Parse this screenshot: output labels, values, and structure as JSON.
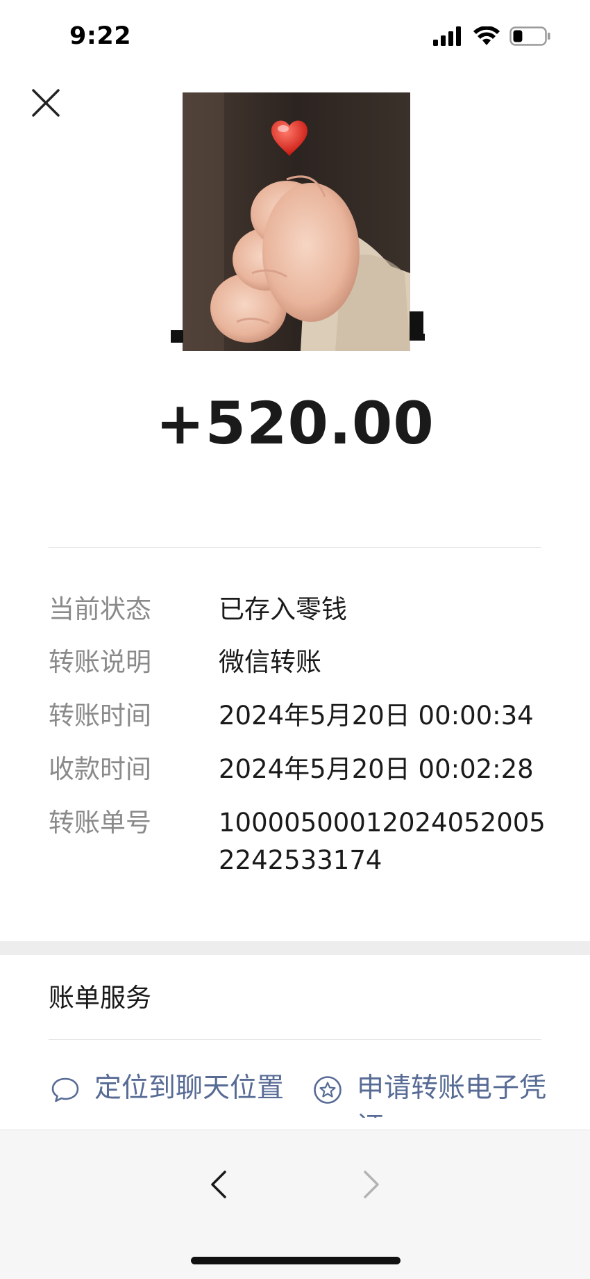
{
  "status_bar": {
    "time": "9:22",
    "battery_level": 0.3
  },
  "transfer": {
    "amount": "+520.00",
    "details": [
      {
        "label": "当前状态",
        "value": "已存入零钱"
      },
      {
        "label": "转账说明",
        "value": "微信转账"
      },
      {
        "label": "转账时间",
        "value": "2024年5月20日 00:00:34"
      },
      {
        "label": "收款时间",
        "value": "2024年5月20日 00:02:28"
      },
      {
        "label": "转账单号",
        "value": "100005000120240520052242533174"
      }
    ]
  },
  "services": {
    "title": "账单服务",
    "actions": [
      {
        "label": "定位到聊天位置",
        "icon": "chat-bubble-icon"
      },
      {
        "label": "申请转账电子凭证",
        "icon": "star-circle-icon"
      }
    ]
  },
  "colors": {
    "link": "#576b95",
    "label": "#8a8a8a",
    "text": "#1a1a1a"
  }
}
